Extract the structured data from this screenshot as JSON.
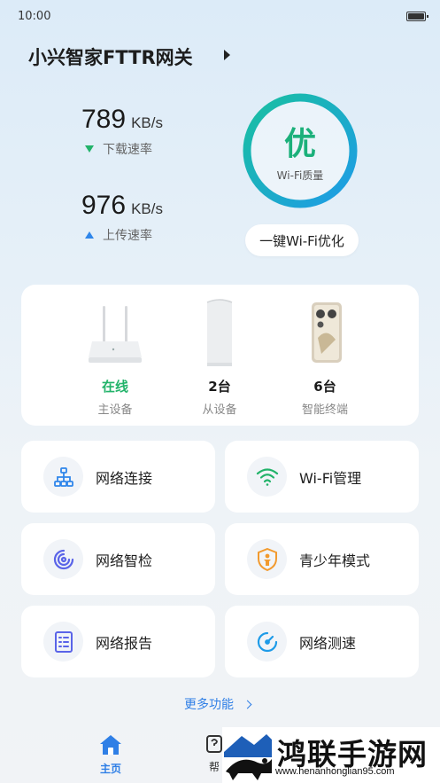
{
  "status_bar": {
    "time": "10:00"
  },
  "header": {
    "title": "小兴智家FTTR网关"
  },
  "speed": {
    "download": {
      "value": "789",
      "unit": "KB/s",
      "label": "下载速率"
    },
    "upload": {
      "value": "976",
      "unit": "KB/s",
      "label": "上传速率"
    }
  },
  "quality": {
    "grade": "优",
    "label": "Wi-Fi质量",
    "optimize_label": "一键Wi-Fi优化"
  },
  "devices": [
    {
      "status": "在线",
      "name": "主设备",
      "status_color": "#22b36a"
    },
    {
      "status": "2台",
      "name": "从设备"
    },
    {
      "status": "6台",
      "name": "智能终端"
    }
  ],
  "features": [
    {
      "label": "网络连接",
      "icon": "network-topology-icon"
    },
    {
      "label": "Wi-Fi管理",
      "icon": "wifi-icon"
    },
    {
      "label": "网络智检",
      "icon": "network-check-icon"
    },
    {
      "label": "青少年模式",
      "icon": "teen-mode-shield-icon"
    },
    {
      "label": "网络报告",
      "icon": "report-document-icon"
    },
    {
      "label": "网络测速",
      "icon": "speedometer-icon"
    }
  ],
  "more_label": "更多功能",
  "nav": {
    "home_label": "主页",
    "help_label": "帮"
  },
  "watermark": {
    "text": "鸿联手游网",
    "url": "www.henanhonglian95.com"
  },
  "colors": {
    "accent": "#2f7fe6",
    "online": "#22b36a",
    "ring_start": "#19c0a0",
    "ring_end": "#1e9be8"
  }
}
